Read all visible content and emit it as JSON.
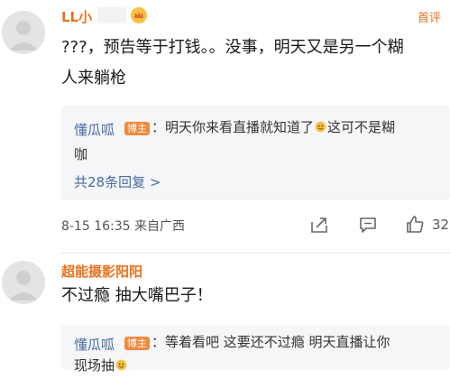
{
  "comments": [
    {
      "username": "LL小",
      "first_tag": "首评",
      "text_line1": "???，预告等于打钱。。没事，明天又是另一个糊",
      "text_line2": "人来躺枪",
      "reply": {
        "author": "懂瓜呱",
        "boss_label": "博主",
        "text_line1": "：明天你来看直播就知道了",
        "text_line1b": "这可不是糊",
        "text_line2": "咖",
        "more": "共28条回复 >"
      },
      "meta": "8-15 16:35  来自广西",
      "likes": "32"
    },
    {
      "username": "超能摄影阳阳",
      "text_line1": "不过瘾 抽大嘴巴子！",
      "reply": {
        "author": "懂瓜呱",
        "boss_label": "博主",
        "text_line1": "：等着看吧  这要还不过瘾 明天直播让你",
        "text_line2": "现场抽"
      }
    }
  ],
  "icons": {
    "share": "share-icon",
    "comment": "comment-icon",
    "like": "thumbs-up-icon",
    "vip": "vip-crown-badge-icon",
    "emoji": "emoji-icon"
  },
  "colors": {
    "username": "#e9731f",
    "reply_author": "#4a6ba1",
    "boss_tag": "#f08a3c",
    "reply_bg": "#f5f6f8"
  }
}
